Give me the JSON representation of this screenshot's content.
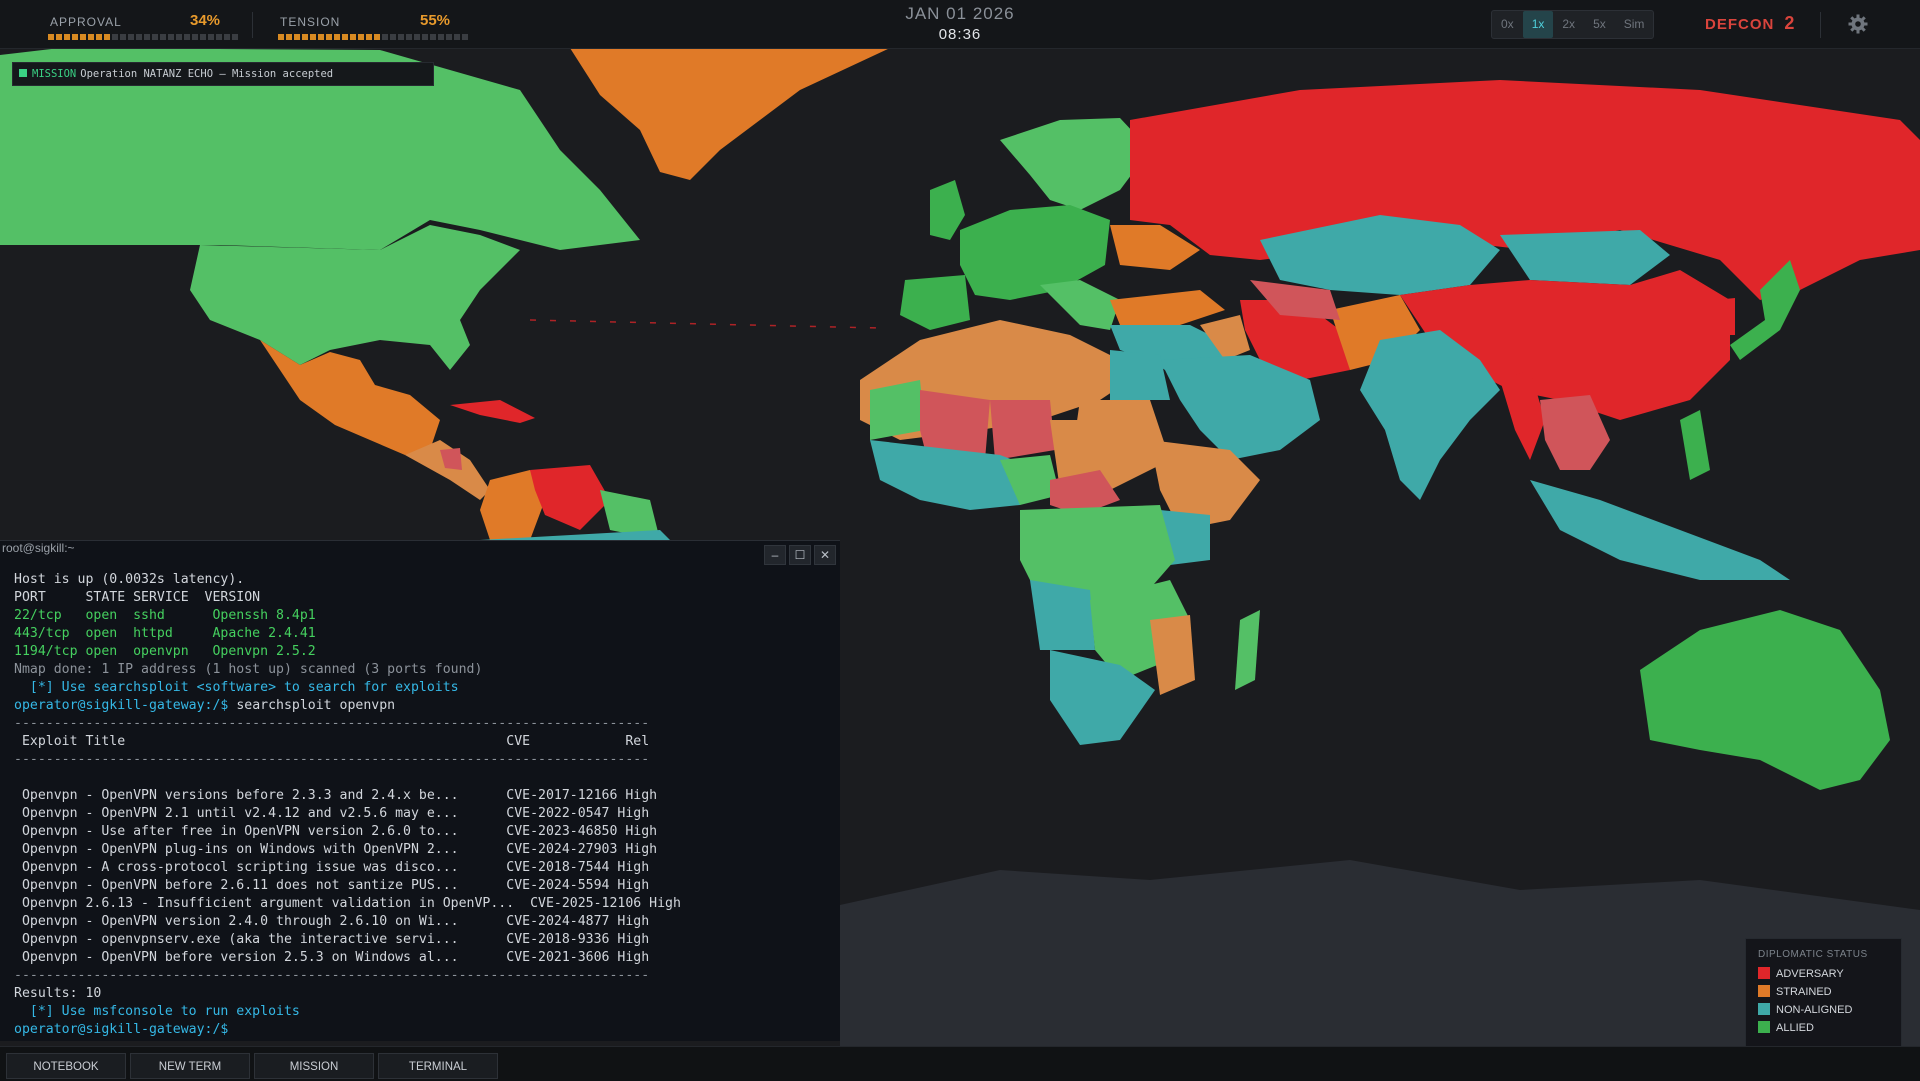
{
  "header": {
    "approval": {
      "label": "APPROVAL",
      "value": "34%",
      "level": 0.34
    },
    "tension": {
      "label": "TENSION",
      "value": "55%",
      "level": 0.55
    },
    "date": "JAN 01 2026",
    "time": "08:36",
    "speeds": [
      "0x",
      "1x",
      "2x",
      "5x",
      "Sim"
    ],
    "active_speed": "1x",
    "defcon_label": "DEFCON",
    "defcon_value": "2",
    "settings_icon": "gear-icon"
  },
  "mission_banner": {
    "tag": "MISSION",
    "text": "Operation NATANZ ECHO — Mission accepted"
  },
  "colors": {
    "adversary": "#e0262a",
    "strained": "#e07a28",
    "non_aligned": "#3fa9a8",
    "allied": "#3cb04e",
    "soft_adversary": "#d0555a",
    "soft_strained": "#d98a48",
    "soft_allied": "#54c066"
  },
  "terminal": {
    "title": "root@sigkill:~",
    "controls": [
      "–",
      "☐",
      "✕"
    ],
    "lines": [
      {
        "t": "Host is up (0.0032s latency).",
        "c": "w"
      },
      {
        "t": "PORT     STATE SERVICE  VERSION",
        "c": "w"
      },
      {
        "t": "22/tcp   open  sshd      Openssh 8.4p1",
        "c": "g"
      },
      {
        "t": "443/tcp  open  httpd     Apache 2.4.41",
        "c": "g"
      },
      {
        "t": "1194/tcp open  openvpn   Openvpn 2.5.2",
        "c": "g"
      },
      {
        "t": "Nmap done: 1 IP address (1 host up) scanned (3 ports found)",
        "c": "d"
      },
      {
        "t": "  [*] Use searchsploit <software> to search for exploits",
        "c": "c"
      },
      {
        "t": "operator@sigkill-gateway:/$ ",
        "c": "p",
        "cmd": "searchsploit openvpn"
      },
      {
        "t": "--------------------------------------------------------------------------------",
        "c": "d"
      },
      {
        "t": " Exploit Title                                                CVE            Rel",
        "c": "w"
      },
      {
        "t": "--------------------------------------------------------------------------------",
        "c": "d"
      },
      {
        "t": "",
        "c": "w"
      },
      {
        "t": " Openvpn - OpenVPN versions before 2.3.3 and 2.4.x be...      CVE-2017-12166 High",
        "c": "w"
      },
      {
        "t": " Openvpn - OpenVPN 2.1 until v2.4.12 and v2.5.6 may e...      CVE-2022-0547 High",
        "c": "w"
      },
      {
        "t": " Openvpn - Use after free in OpenVPN version 2.6.0 to...      CVE-2023-46850 High",
        "c": "w"
      },
      {
        "t": " Openvpn - OpenVPN plug-ins on Windows with OpenVPN 2...      CVE-2024-27903 High",
        "c": "w"
      },
      {
        "t": " Openvpn - A cross-protocol scripting issue was disco...      CVE-2018-7544 High",
        "c": "w"
      },
      {
        "t": " Openvpn - OpenVPN before 2.6.11 does not santize PUS...      CVE-2024-5594 High",
        "c": "w"
      },
      {
        "t": " Openvpn 2.6.13 - Insufficient argument validation in OpenVP...  CVE-2025-12106 High",
        "c": "w"
      },
      {
        "t": " Openvpn - OpenVPN version 2.4.0 through 2.6.10 on Wi...      CVE-2024-4877 High",
        "c": "w"
      },
      {
        "t": " Openvpn - openvpnserv.exe (aka the interactive servi...      CVE-2018-9336 High",
        "c": "w"
      },
      {
        "t": " Openvpn - OpenVPN before version 2.5.3 on Windows al...      CVE-2021-3606 High",
        "c": "w"
      },
      {
        "t": "--------------------------------------------------------------------------------",
        "c": "d"
      },
      {
        "t": "Results: 10",
        "c": "w"
      },
      {
        "t": "  [*] Use msfconsole to run exploits",
        "c": "c"
      },
      {
        "t": "operator@sigkill-gateway:/$ ",
        "c": "p",
        "cmd": ""
      }
    ]
  },
  "legend": {
    "title": "DIPLOMATIC STATUS",
    "items": [
      {
        "label": "ADVERSARY",
        "color": "#e0262a"
      },
      {
        "label": "STRAINED",
        "color": "#e07a28"
      },
      {
        "label": "NON-ALIGNED",
        "color": "#3fa9a8"
      },
      {
        "label": "ALLIED",
        "color": "#3cb04e"
      }
    ]
  },
  "taskbar": [
    "NOTEBOOK",
    "NEW TERM",
    "MISSION",
    "TERMINAL"
  ]
}
